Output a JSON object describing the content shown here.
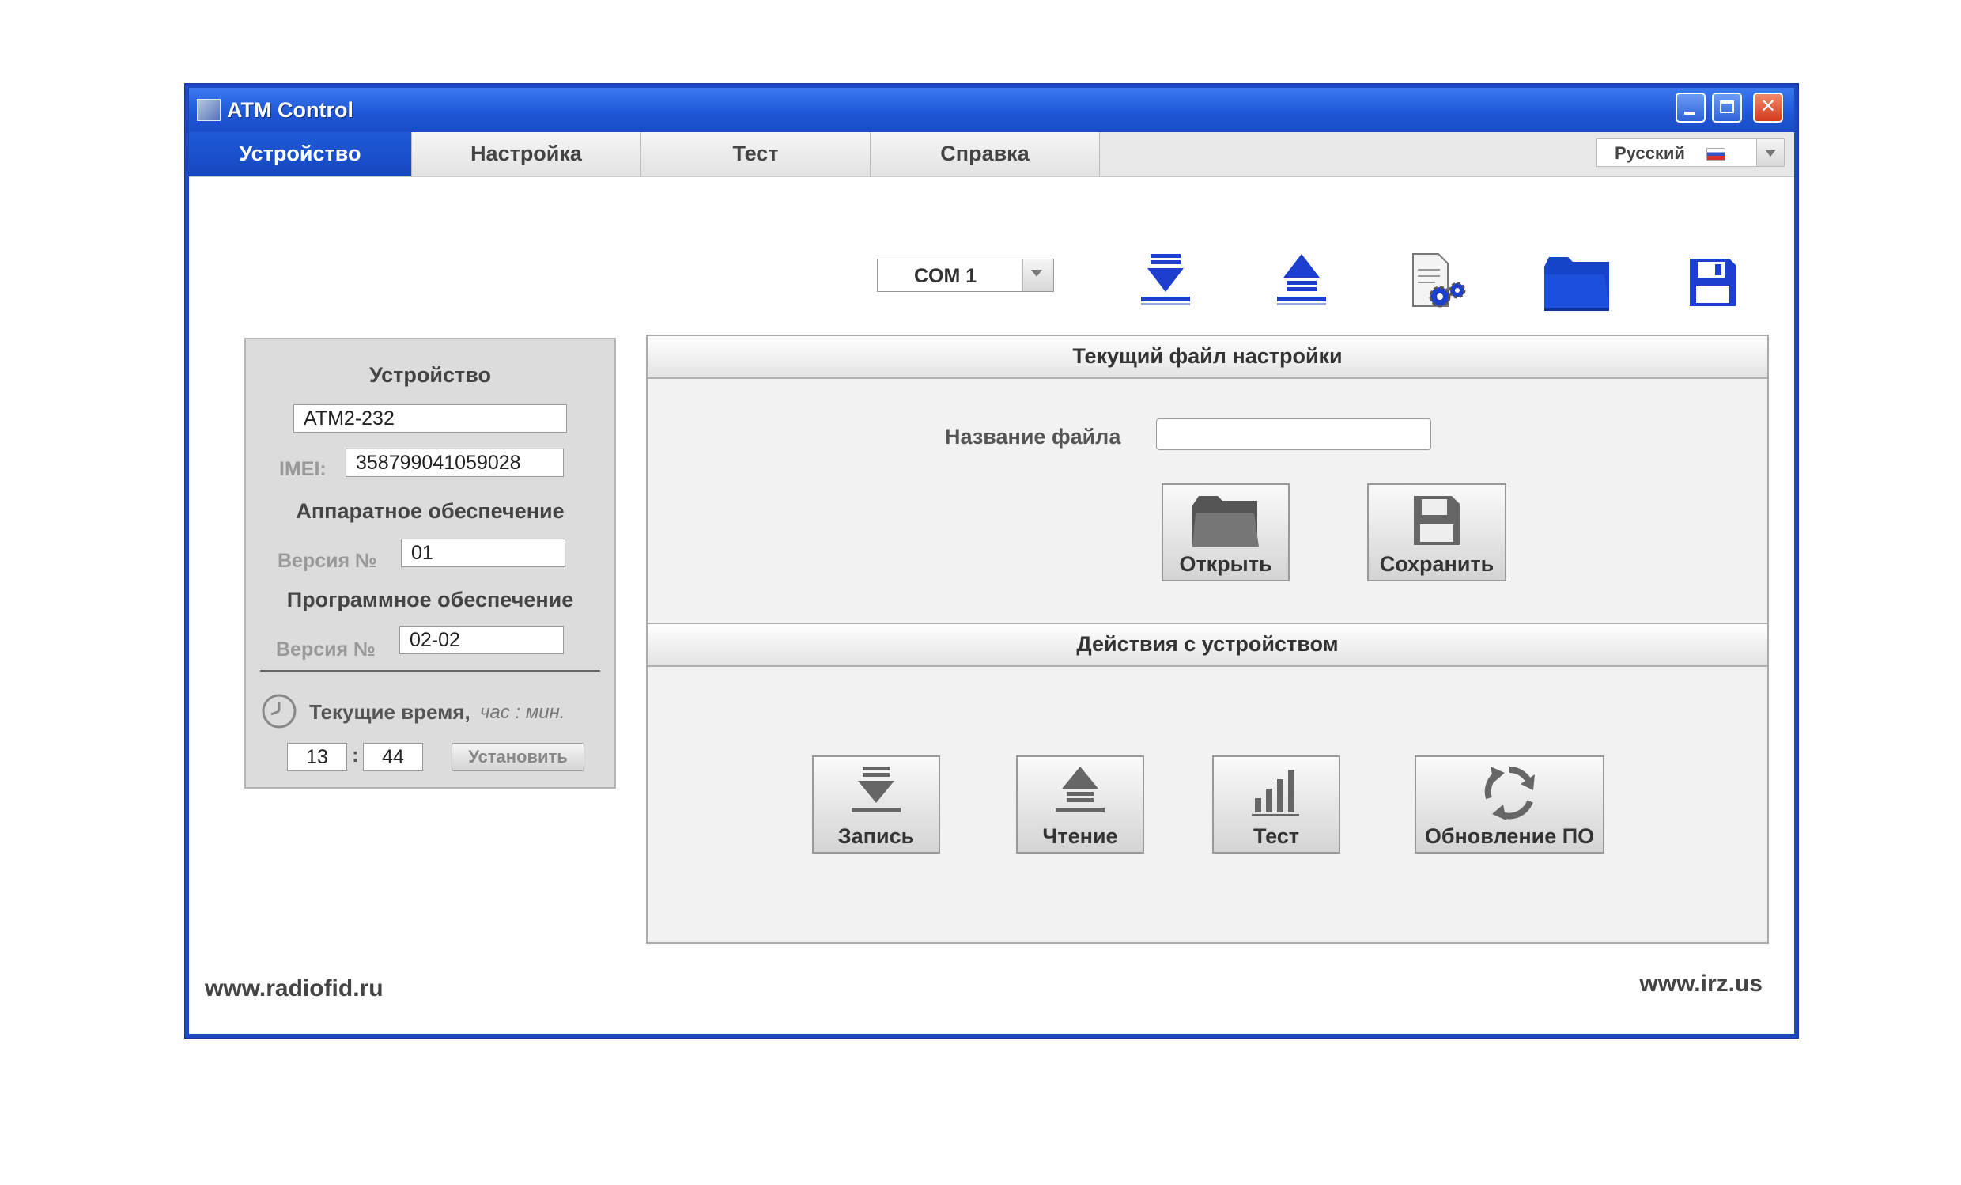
{
  "window": {
    "title": "ATM Control"
  },
  "tabs": [
    {
      "label": "Устройство",
      "active": true
    },
    {
      "label": "Настройка",
      "active": false
    },
    {
      "label": "Тест",
      "active": false
    },
    {
      "label": "Справка",
      "active": false
    }
  ],
  "language": {
    "selected": "Русский"
  },
  "toolbar": {
    "com_port": "COM 1",
    "icons": [
      "download-icon",
      "upload-icon",
      "settings-file-icon",
      "folder-icon",
      "floppy-disk-icon"
    ]
  },
  "device_panel": {
    "device_heading": "Устройство",
    "device_model": "ATM2-232",
    "imei_label": "IMEI:",
    "imei_value": "358799041059028",
    "hardware_heading": "Аппаратное обеспечение",
    "hardware_version_label": "Версия №",
    "hardware_version": "01",
    "software_heading": "Программное обеспечение",
    "software_version_label": "Версия №",
    "software_version": "02-02",
    "time_label": "Текущие время,",
    "time_units": "час : мин.",
    "hours": "13",
    "separator": ":",
    "minutes": "44",
    "set_button": "Установить"
  },
  "config_file": {
    "heading": "Текущий файл настройки",
    "filename_label": "Название файла",
    "filename_value": "",
    "open_button": "Открыть",
    "save_button": "Сохранить"
  },
  "device_actions": {
    "heading": "Действия с устройством",
    "write_button": "Запись",
    "read_button": "Чтение",
    "test_button": "Тест",
    "update_button": "Обновление ПО"
  },
  "footer": {
    "left_link": "www.radiofid.ru",
    "right_link": "www.irz.us"
  },
  "colors": {
    "titlebar": "#1e56d6",
    "active_tab": "#1f5ad8",
    "toolbar_icon": "#1c3fd0"
  }
}
